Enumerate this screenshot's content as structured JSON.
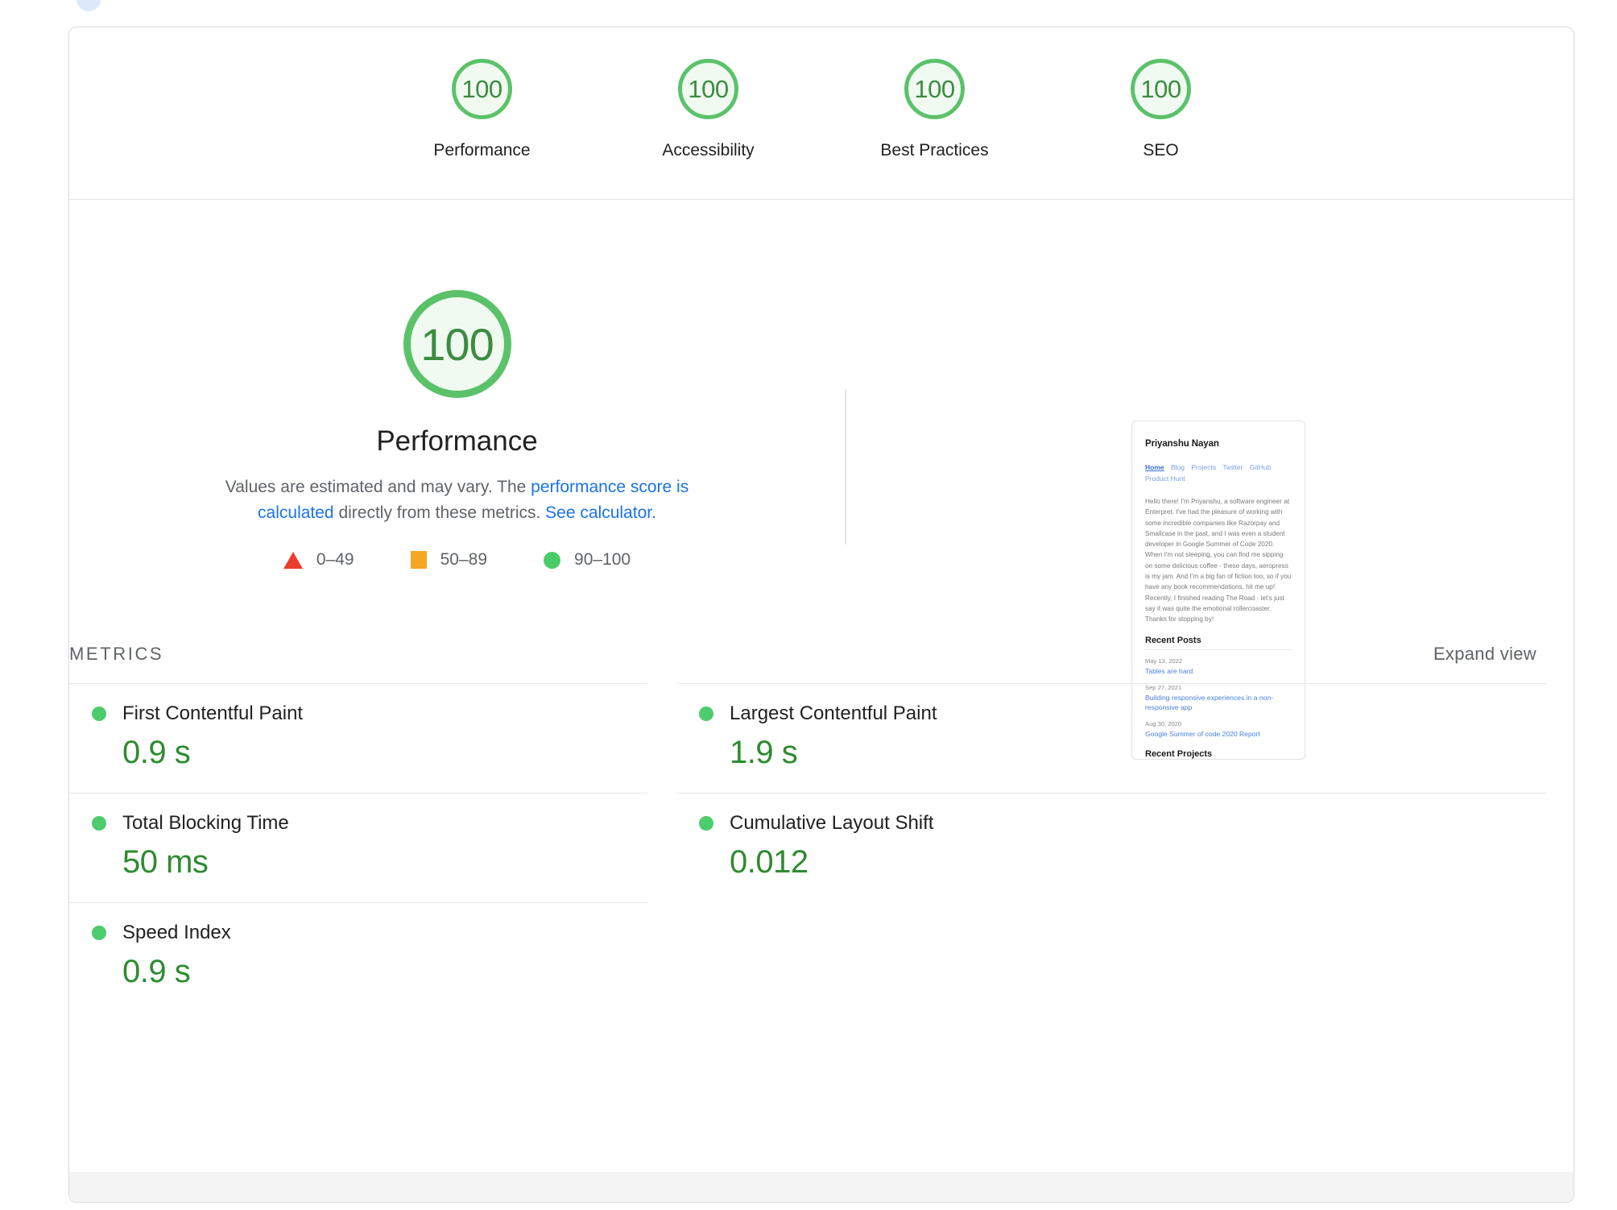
{
  "summary": {
    "scores": [
      {
        "value": "100",
        "label": "Performance"
      },
      {
        "value": "100",
        "label": "Accessibility"
      },
      {
        "value": "100",
        "label": "Best Practices"
      },
      {
        "value": "100",
        "label": "SEO"
      }
    ]
  },
  "hero": {
    "score": "100",
    "title": "Performance",
    "desc_part1": "Values are estimated and may vary. The ",
    "desc_link1": "performance score is calculated",
    "desc_part2": " directly from these metrics. ",
    "desc_link2": "See calculator.",
    "legend": [
      {
        "icon": "triangle-red-icon",
        "label": "0–49"
      },
      {
        "icon": "square-orange-icon",
        "label": "50–89"
      },
      {
        "icon": "circle-green-icon",
        "label": "90–100"
      }
    ]
  },
  "thumbnail": {
    "site_name": "Priyanshu Nayan",
    "nav": [
      {
        "label": "Home",
        "active": true
      },
      {
        "label": "Blog",
        "active": false
      },
      {
        "label": "Projects",
        "active": false
      },
      {
        "label": "Twitter",
        "active": false
      },
      {
        "label": "GitHub",
        "active": false
      },
      {
        "label": "Product Hunt",
        "active": false
      }
    ],
    "bio": "Hello there! I'm Priyanshu, a software engineer at Enterpret. I've had the pleasure of working with some incredible companies like Razorpay and Smallcase in the past, and I was even a student developer in Google Summer of Code 2020. When I'm not sleeping, you can find me sipping on some delicious coffee - these days, aeropress is my jam. And I'm a big fan of fiction too, so if you have any book recommendations, hit me up! Recently, I finished reading The Road - let's just say it was quite the emotional rollercoaster. Thanks for stopping by!",
    "recent_posts_heading": "Recent Posts",
    "posts": [
      {
        "date": "May 13, 2022",
        "title": "Tables are hard"
      },
      {
        "date": "Sep 27, 2021",
        "title": "Building responsive experiences in a non-responsive app"
      },
      {
        "date": "Aug 30, 2020",
        "title": "Google Summer of code 2020 Report"
      }
    ],
    "clipped_heading": "Recent Projects"
  },
  "metrics": {
    "section_title": "METRICS",
    "expand_label": "Expand view",
    "left": [
      {
        "name": "First Contentful Paint",
        "value": "0.9 s",
        "status": "pass"
      },
      {
        "name": "Total Blocking Time",
        "value": "50 ms",
        "status": "pass"
      },
      {
        "name": "Speed Index",
        "value": "0.9 s",
        "status": "pass"
      }
    ],
    "right": [
      {
        "name": "Largest Contentful Paint",
        "value": "1.9 s",
        "status": "pass"
      },
      {
        "name": "Cumulative Layout Shift",
        "value": "0.012",
        "status": "pass"
      }
    ]
  },
  "colors": {
    "pass_green": "#4ccc6c",
    "gauge_ring": "#5bc26a",
    "gauge_fill": "#f0faf1",
    "score_text": "#3c8c40",
    "metric_value": "#2e8b31",
    "link_blue": "#1a73e8",
    "average_orange": "#f5a623",
    "fail_red": "#eb3d2e"
  }
}
